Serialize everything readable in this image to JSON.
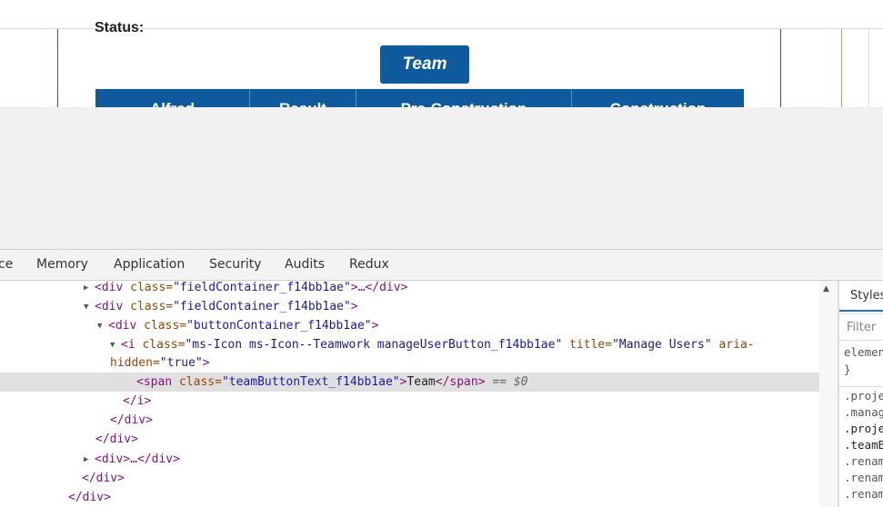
{
  "page": {
    "status_label": "Status:",
    "team_button_label": "Team",
    "table_headers": [
      "Alfred",
      "Result",
      "Pre-Construction",
      "Construction"
    ]
  },
  "devtools": {
    "tabs": [
      "ce",
      "Memory",
      "Application",
      "Security",
      "Audits",
      "Redux"
    ],
    "elements": {
      "lines": [
        {
          "open": "<div ",
          "attr": "class=",
          "value": "\"fieldContainer_f14bb1ae\"",
          "close": ">…</div>"
        },
        {
          "open": "<div ",
          "attr": "class=",
          "value": "\"fieldContainer_f14bb1ae\"",
          "close": ">"
        },
        {
          "open": "<div ",
          "attr": "class=",
          "value": "\"buttonContainer_f14bb1ae\"",
          "close": ">"
        },
        {
          "open": "<i ",
          "attr": "class=",
          "value": "\"ms-Icon ms-Icon--Teamwork manageUserButton_f14bb1ae\"",
          "attr2": " title=",
          "value2": "\"Manage Users\"",
          "attr3": " aria-"
        },
        {
          "attr": "hidden=",
          "value": "\"true\"",
          "close": ">"
        },
        {
          "open": "<span ",
          "attr": "class=",
          "value": "\"teamButtonText_f14bb1ae\"",
          "mid": ">",
          "text": "Team",
          "close": "</span>",
          "eq": " == $0"
        },
        {
          "close": "</i>"
        },
        {
          "close": "</div>"
        },
        {
          "close": "</div>"
        },
        {
          "open": "<div>",
          "close": "…</div>"
        },
        {
          "close": "</div>"
        },
        {
          "close": "</div>"
        }
      ]
    },
    "styles_panel": {
      "tab_label": "Styles",
      "filter_placeholder": "Filter",
      "element_style": "element.style {",
      "element_style_close": "}",
      "rules": [
        ".proje",
        ".manag",
        ".proje",
        ".teamB",
        ".renam",
        ".renam",
        ".renam"
      ]
    }
  }
}
